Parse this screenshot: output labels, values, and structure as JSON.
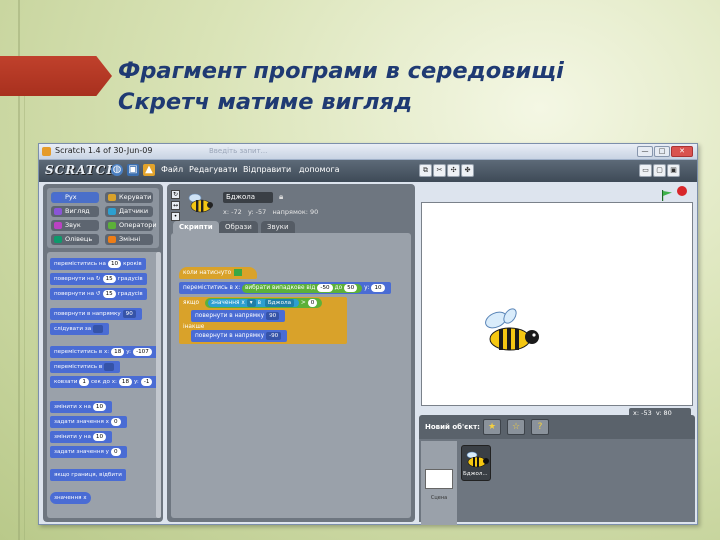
{
  "slide": {
    "title_line1": "Фрагмент програми в середовищі",
    "title_line2": "Скретч матиме вигляд"
  },
  "window": {
    "title": "Scratch 1.4 of 30-Jun-09",
    "ghost_text": "Введіть запит...",
    "min": "—",
    "max": "□",
    "close": "✕"
  },
  "menubar": {
    "logo": "SCRATCH",
    "items": [
      "Файл",
      "Редагувати",
      "Відправити",
      "допомога"
    ],
    "icons": [
      "globe-icon",
      "save-icon",
      "share-icon"
    ]
  },
  "categories": [
    {
      "label": "Рух",
      "color": "#4a6cd4"
    },
    {
      "label": "Вигляд",
      "color": "#8a55d7"
    },
    {
      "label": "Звук",
      "color": "#bb42c3"
    },
    {
      "label": "Олівець",
      "color": "#0e9a6c"
    },
    {
      "label": "Керувати",
      "color": "#d9a22a"
    },
    {
      "label": "Датчики",
      "color": "#2d9fd0"
    },
    {
      "label": "Оператори",
      "color": "#5cb039"
    },
    {
      "label": "Змінні",
      "color": "#ee7d16"
    }
  ],
  "palette_blocks": {
    "move": {
      "a": "переміститись на",
      "n": "10",
      "b": "кроків"
    },
    "turn_cw": {
      "a": "повернути на",
      "n": "15",
      "b": "градусів"
    },
    "turn_ccw": {
      "a": "повернути на",
      "n": "15",
      "b": "градусів"
    },
    "point_dir": {
      "a": "повернути в напрямку",
      "v": "90"
    },
    "point_towards": {
      "a": "слідувати за"
    },
    "goto_xy": {
      "a": "переміститись в x:",
      "x": "18",
      "b": "y:",
      "y": "-107"
    },
    "goto": {
      "a": "переміститись в"
    },
    "glide": {
      "a": "ковзати",
      "n": "1",
      "b": "сек до x:",
      "x": "18",
      "c": "y:",
      "y": "-1"
    },
    "change_x": {
      "a": "змінити х на",
      "n": "10"
    },
    "set_x": {
      "a": "задати значення х",
      "n": "0"
    },
    "change_y": {
      "a": "змінити у на",
      "n": "10"
    },
    "set_y": {
      "a": "задати значення у",
      "n": "0"
    },
    "bounce": {
      "a": "якщо границя, відбити"
    },
    "x_position": {
      "a": "значення х"
    }
  },
  "sprite": {
    "name": "Бджола",
    "x_label": "x:",
    "x": "-72",
    "y_label": "y:",
    "y": "-57",
    "dir_label": "напрямок:",
    "dir": "90"
  },
  "tabs": [
    "Скрипти",
    "Образи",
    "Звуки"
  ],
  "script": {
    "hat": "коли натиснуто",
    "goto": {
      "a": "переміститись в х:",
      "rand": "вибрати випадкове від",
      "from": "-50",
      "to_label": "до",
      "to": "50",
      "b": "у:",
      "y": "10"
    },
    "if_label": "якщо",
    "sensor": {
      "a": "значення х",
      "b": "в",
      "c": "Бджола"
    },
    "op": ">",
    "op_val": "0",
    "turn1": {
      "a": "повернути в напрямку",
      "v": "90"
    },
    "else_label": "інакше",
    "turn2": {
      "a": "повернути в напрямку",
      "v": "-90"
    }
  },
  "stage": {
    "mouse_x_label": "x:",
    "mouse_x": "-53",
    "mouse_y_label": "y:",
    "mouse_y": "80"
  },
  "sprite_list": {
    "new_sprite_label": "Новий об'єкт:",
    "stage_label": "Сцена",
    "sprite_tile_label": "Бджол..."
  },
  "colors": {
    "title": "#1f3a73",
    "arrow": "#b53a25",
    "motion": "#4a6cd4",
    "control": "#d9a22a",
    "operators": "#5cb039",
    "sensing": "#2d9fd0"
  }
}
